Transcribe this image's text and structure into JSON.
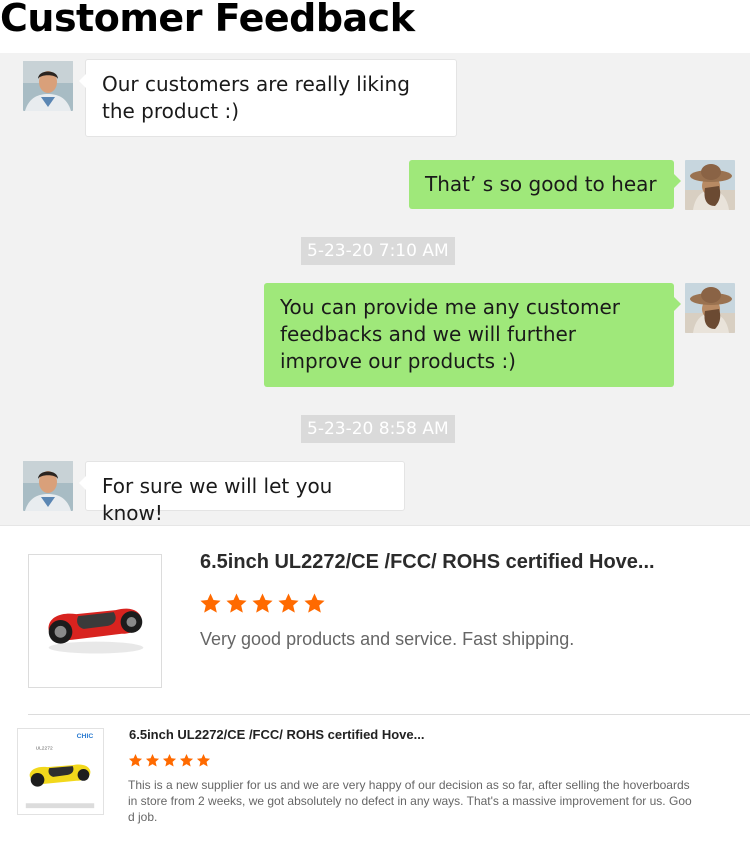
{
  "page": {
    "title": "Customer Feedback"
  },
  "chat": {
    "messages": [
      {
        "side": "left",
        "avatar": "male-avatar",
        "text": "Our customers are really liking the product :)"
      },
      {
        "side": "right",
        "avatar": "female-avatar",
        "text": "That’ s so good to hear"
      },
      {
        "side": "right",
        "avatar": "female-avatar",
        "text": "You can provide me any customer feedbacks and we will further improve our products :)"
      },
      {
        "side": "left",
        "avatar": "male-avatar",
        "text": "For sure we will let you know!"
      }
    ],
    "timestamps": [
      "5-23-20 7:10 AM",
      "5-23-20 8:58 AM"
    ]
  },
  "reviews": [
    {
      "title": "6.5inch UL2272/CE /FCC/ ROHS certified Hove...",
      "rating": 5,
      "max_rating": 5,
      "text": "Very good products and service. Fast shipping.",
      "thumbnail": "red-hoverboard-image"
    },
    {
      "title": "6.5inch UL2272/CE /FCC/ ROHS certified Hove...",
      "rating": 5,
      "max_rating": 5,
      "text": "This is a new supplier for us and we are very happy of our decision as so far, after selling the hoverboards in store from 2 weeks, we got absolutely no defect in any ways. That's a massive improvement for us. Good job.",
      "thumbnail": "yellow-hoverboard-image",
      "thumb_brand": "CHIC",
      "thumb_model": "UL2272"
    }
  ],
  "colors": {
    "chat_bg": "#f2f2f2",
    "outgoing_bubble": "#9fe87a",
    "incoming_bubble": "#ffffff",
    "timestamp_bg": "#dadada",
    "star": "#ff6a00"
  }
}
